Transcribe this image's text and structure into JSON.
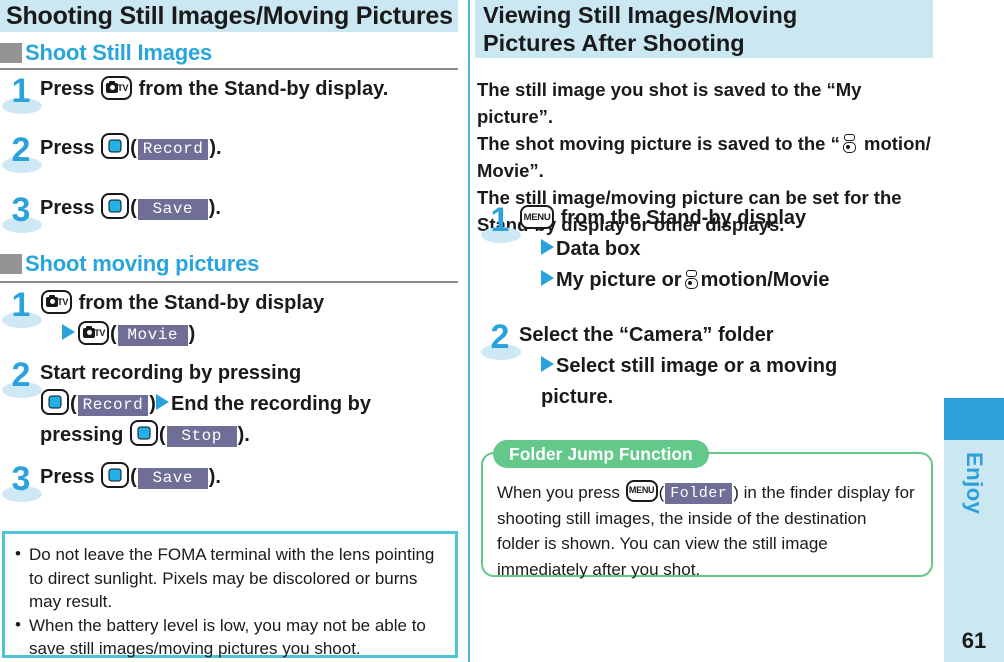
{
  "left": {
    "banner_title": "Shooting Still Images/Moving Pictures",
    "section1": {
      "marker": "gray-square-marker",
      "title": "Shoot Still Images",
      "steps": [
        {
          "number": "1",
          "press_label": "Press",
          "key": "camera-tv-key",
          "key_tv_text": "TV",
          "tail": "from the Stand-by display."
        },
        {
          "number": "2",
          "press_label": "Press",
          "key": "center-key",
          "softkey": "Record",
          "tail": ")."
        },
        {
          "number": "3",
          "press_label": "Press",
          "key": "center-key",
          "softkey": "Save",
          "tail": ")."
        }
      ]
    },
    "section2": {
      "marker": "gray-square-marker",
      "title": "Shoot moving pictures",
      "steps": [
        {
          "number": "1",
          "line1_tail": "from the Stand-by display",
          "line2_softkey": "Movie"
        },
        {
          "number": "2",
          "line1": "Start recording by pressing",
          "softkey1": "Record",
          "line2_mid": "End the recording by",
          "line3_pre": "pressing",
          "softkey2": "Stop",
          "line3_tail": ")."
        },
        {
          "number": "3",
          "press_label": "Press",
          "softkey": "Save",
          "tail": ")."
        }
      ]
    },
    "notes": [
      "Do not leave the FOMA terminal with the lens pointing to direct sunlight. Pixels may be discolored or burns may result.",
      "When the battery level is low, you may not be able to save still images/moving pictures you shoot."
    ]
  },
  "right": {
    "banner_line1": "Viewing Still Images/Moving",
    "banner_line2": "Pictures After Shooting",
    "intro": {
      "p1": "The still image you shot is saved to the “My picture”.",
      "p2a": "The shot moving picture is saved to the “",
      "p2b": " motion/",
      "p3": "Movie”.",
      "p4": "The still image/moving picture can be set for the",
      "p5": "Stand-by display or other displays."
    },
    "steps": [
      {
        "number": "1",
        "key": "menu-key",
        "key_text": "MENU",
        "line1_tail": "from the Stand-by display",
        "line2": "Data box",
        "line3a": "My picture or",
        "line3b": "motion/Movie"
      },
      {
        "number": "2",
        "line1": "Select the “Camera” folder",
        "line2": "Select still image or a moving",
        "line3": "picture."
      }
    ],
    "callout": {
      "tab_title": "Folder Jump Function",
      "text_a": "When you press",
      "key_text": "MENU",
      "softkey": "Folder",
      "text_b": ") in the finder display for",
      "text_c": "shooting still images, the inside of the destination",
      "text_d": "folder is shown. You can view the still image",
      "text_e": "immediately after you shot."
    }
  },
  "rail": {
    "label": "Enjoy",
    "page_number": "61",
    "accent_color": "#2CA0D8",
    "band_color": "#CBE7F2"
  }
}
